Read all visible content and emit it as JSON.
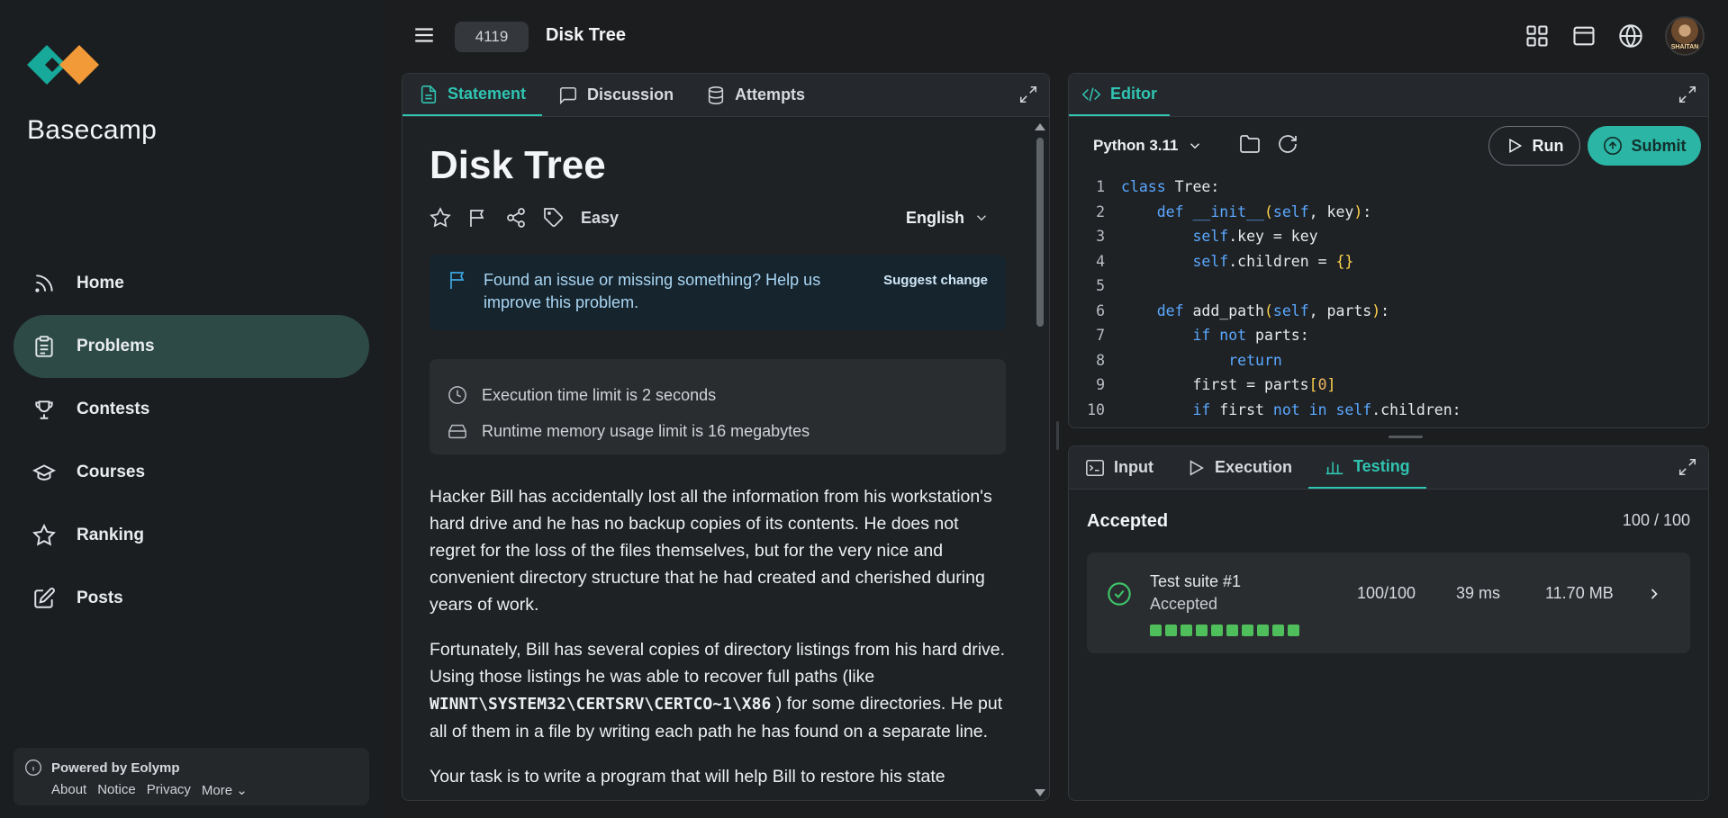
{
  "brand": {
    "name": "Basecamp"
  },
  "nav": [
    {
      "label": "Home",
      "icon": "rss-icon"
    },
    {
      "label": "Problems",
      "icon": "clipboard-icon",
      "active": true
    },
    {
      "label": "Contests",
      "icon": "trophy-icon"
    },
    {
      "label": "Courses",
      "icon": "graduation-cap-icon"
    },
    {
      "label": "Ranking",
      "icon": "star-icon"
    },
    {
      "label": "Posts",
      "icon": "edit-icon"
    }
  ],
  "footer": {
    "powered": "Powered by Eolymp",
    "links": [
      "About",
      "Notice",
      "Privacy",
      "More"
    ]
  },
  "header": {
    "problem_id": "4119",
    "title": "Disk Tree",
    "avatar_text": "SHAITAN"
  },
  "statement_tabs": [
    "Statement",
    "Discussion",
    "Attempts"
  ],
  "statement": {
    "title": "Disk Tree",
    "difficulty": "Easy",
    "language": "English",
    "issue_text": "Found an issue or missing something? Help us improve this problem.",
    "suggest": "Suggest change",
    "time_limit": "Execution time limit is 2 seconds",
    "memory_limit": "Runtime memory usage limit is 16 megabytes",
    "para1": "Hacker Bill has accidentally lost all the information from his workstation's hard drive and he has no backup copies of its contents. He does not regret for the loss of the files themselves, but for the very nice and convenient directory structure that he had created and cherished during years of work.",
    "para2_a": "Fortunately, Bill has several copies of directory listings from his hard drive. Using those listings he was able to recover full paths (like",
    "para2_code": "WINNT\\SYSTEM32\\CERTSRV\\CERTCO~1\\X86",
    "para2_b": ") for some directories. He put all of them in a file by writing each path he has found on a separate line.",
    "para3": "Your task is to write a program that will help Bill to restore his state"
  },
  "editor": {
    "tab": "Editor",
    "language": "Python 3.11",
    "run": "Run",
    "submit": "Submit"
  },
  "bottom_tabs": [
    "Input",
    "Execution",
    "Testing"
  ],
  "testing": {
    "status": "Accepted",
    "score": "100 / 100",
    "suite_name": "Test suite #1",
    "suite_status": "Accepted",
    "suite_score": "100/100",
    "suite_time": "39 ms",
    "suite_memory": "11.70 MB",
    "tests_passed": 10
  },
  "colors": {
    "accent": "#30c4b2",
    "success": "#4fbf5b",
    "active_nav": "#2d4a46"
  }
}
